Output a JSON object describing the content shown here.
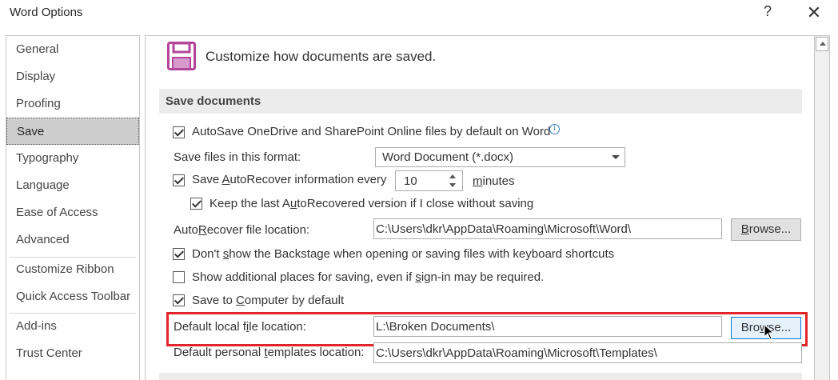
{
  "window": {
    "title": "Word Options",
    "help_glyph": "?",
    "close_glyph": "✕"
  },
  "nav": {
    "items": [
      {
        "label": "General"
      },
      {
        "label": "Display"
      },
      {
        "label": "Proofing"
      },
      {
        "label": "Save",
        "selected": true
      },
      {
        "label": "Typography"
      },
      {
        "label": "Language"
      },
      {
        "label": "Ease of Access"
      },
      {
        "label": "Advanced"
      },
      {
        "label": "Customize Ribbon"
      },
      {
        "label": "Quick Access Toolbar"
      },
      {
        "label": "Add-ins"
      },
      {
        "label": "Trust Center"
      }
    ]
  },
  "header": {
    "icon": "save-floppy-icon",
    "text": "Customize how documents are saved.",
    "icon_color": "#b4469b"
  },
  "save_documents": {
    "section_title": "Save documents",
    "autosave": {
      "label": "AutoSave OneDrive and SharePoint Online files by default on Word",
      "checked": true,
      "info_glyph": "i"
    },
    "format": {
      "label": "Save files in this format:",
      "value": "Word Document (*.docx)"
    },
    "autorecover": {
      "label_pre": "Save ",
      "label_u": "A",
      "label_post": "utoRecover information every",
      "value": "10",
      "unit_u": "m",
      "unit_post": "inutes",
      "checked": true
    },
    "keep_last": {
      "label_pre": "Keep the last A",
      "label_u": "u",
      "label_post": "toRecovered version if I close without saving",
      "checked": true
    },
    "autorecover_location": {
      "label_pre": "Auto",
      "label_u": "R",
      "label_post": "ecover file location:",
      "value": "C:\\Users\\dkr\\AppData\\Roaming\\Microsoft\\Word\\",
      "browse_pre": "",
      "browse_u": "B",
      "browse_post": "rowse..."
    },
    "backstage": {
      "label_pre": "Don't ",
      "label_u": "s",
      "label_post": "how the Backstage when opening or saving files with keyboard shortcuts",
      "checked": true
    },
    "additional_places": {
      "label_pre": "Show additional places for saving, even if ",
      "label_u": "s",
      "label_post": "ign-in may be required.",
      "checked": false
    },
    "save_to_computer": {
      "label_pre": "Save to ",
      "label_u": "C",
      "label_post": "omputer by default",
      "checked": true
    },
    "default_local": {
      "label_pre": "Default local f",
      "label_u": "i",
      "label_post": "le location:",
      "value": "L:\\Broken Documents\\",
      "browse_pre": "Bro",
      "browse_u": "w",
      "browse_post": "se..."
    },
    "default_templates": {
      "label_pre": "Default personal ",
      "label_u": "t",
      "label_post": "emplates location:",
      "value": "C:\\Users\\dkr\\AppData\\Roaming\\Microsoft\\Templates\\"
    }
  },
  "colors": {
    "highlight": "#e0262b",
    "accent": "#0078d7"
  }
}
